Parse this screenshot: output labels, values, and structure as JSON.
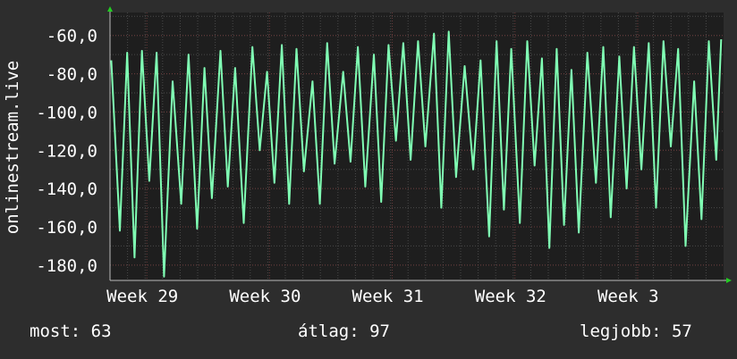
{
  "chart_data": {
    "type": "line",
    "ylabel": "onlinestream.live",
    "ylim": [
      -188,
      -48
    ],
    "yticks": [
      -60,
      -80,
      -100,
      -120,
      -140,
      -160,
      -180
    ],
    "ytick_labels": [
      "-60,0",
      "-80,0",
      "-100,0",
      "-120,0",
      "-140,0",
      "-160,0",
      "-180,0"
    ],
    "xlim": [
      28.7,
      33.7
    ],
    "xticks": [
      29,
      30,
      31,
      32,
      33
    ],
    "xtick_labels": [
      "Week 29",
      "Week 30",
      "Week 31",
      "Week 32",
      "Week 3"
    ],
    "grid": true,
    "series": [
      {
        "color": "#80ffb4",
        "x": [
          28.71,
          28.78,
          28.84,
          28.9,
          28.96,
          29.02,
          29.08,
          29.14,
          29.21,
          29.28,
          29.34,
          29.41,
          29.47,
          29.53,
          29.6,
          29.66,
          29.72,
          29.79,
          29.86,
          29.92,
          29.98,
          30.04,
          30.1,
          30.16,
          30.22,
          30.28,
          30.35,
          30.41,
          30.47,
          30.53,
          30.6,
          30.66,
          30.72,
          30.78,
          30.85,
          30.91,
          30.97,
          31.03,
          31.09,
          31.15,
          31.21,
          31.27,
          31.34,
          31.4,
          31.46,
          31.52,
          31.59,
          31.66,
          31.72,
          31.79,
          31.85,
          31.91,
          31.97,
          32.04,
          32.1,
          32.16,
          32.22,
          32.28,
          32.34,
          32.4,
          32.46,
          32.52,
          32.59,
          32.66,
          32.72,
          32.78,
          32.85,
          32.91,
          32.97,
          33.03,
          33.09,
          33.15,
          33.21,
          33.27,
          33.33,
          33.39,
          33.46,
          33.52,
          33.58,
          33.64,
          33.68
        ],
        "y": [
          -73,
          -162,
          -69,
          -176,
          -68,
          -136,
          -69,
          -186,
          -84,
          -148,
          -70,
          -161,
          -77,
          -145,
          -68,
          -139,
          -77,
          -158,
          -66,
          -120,
          -79,
          -137,
          -65,
          -148,
          -67,
          -131,
          -84,
          -148,
          -64,
          -127,
          -79,
          -126,
          -66,
          -139,
          -70,
          -147,
          -65,
          -115,
          -64,
          -125,
          -63,
          -118,
          -59,
          -150,
          -58,
          -134,
          -76,
          -130,
          -73,
          -165,
          -63,
          -151,
          -67,
          -158,
          -63,
          -128,
          -72,
          -171,
          -67,
          -159,
          -78,
          -163,
          -69,
          -137,
          -66,
          -155,
          -71,
          -140,
          -66,
          -130,
          -64,
          -150,
          -63,
          -118,
          -67,
          -170,
          -84,
          -156,
          -63,
          -125,
          -62
        ]
      }
    ]
  },
  "stats": {
    "current": "most: 63",
    "average": "átlag: 97",
    "best": "legjobb: 57"
  }
}
